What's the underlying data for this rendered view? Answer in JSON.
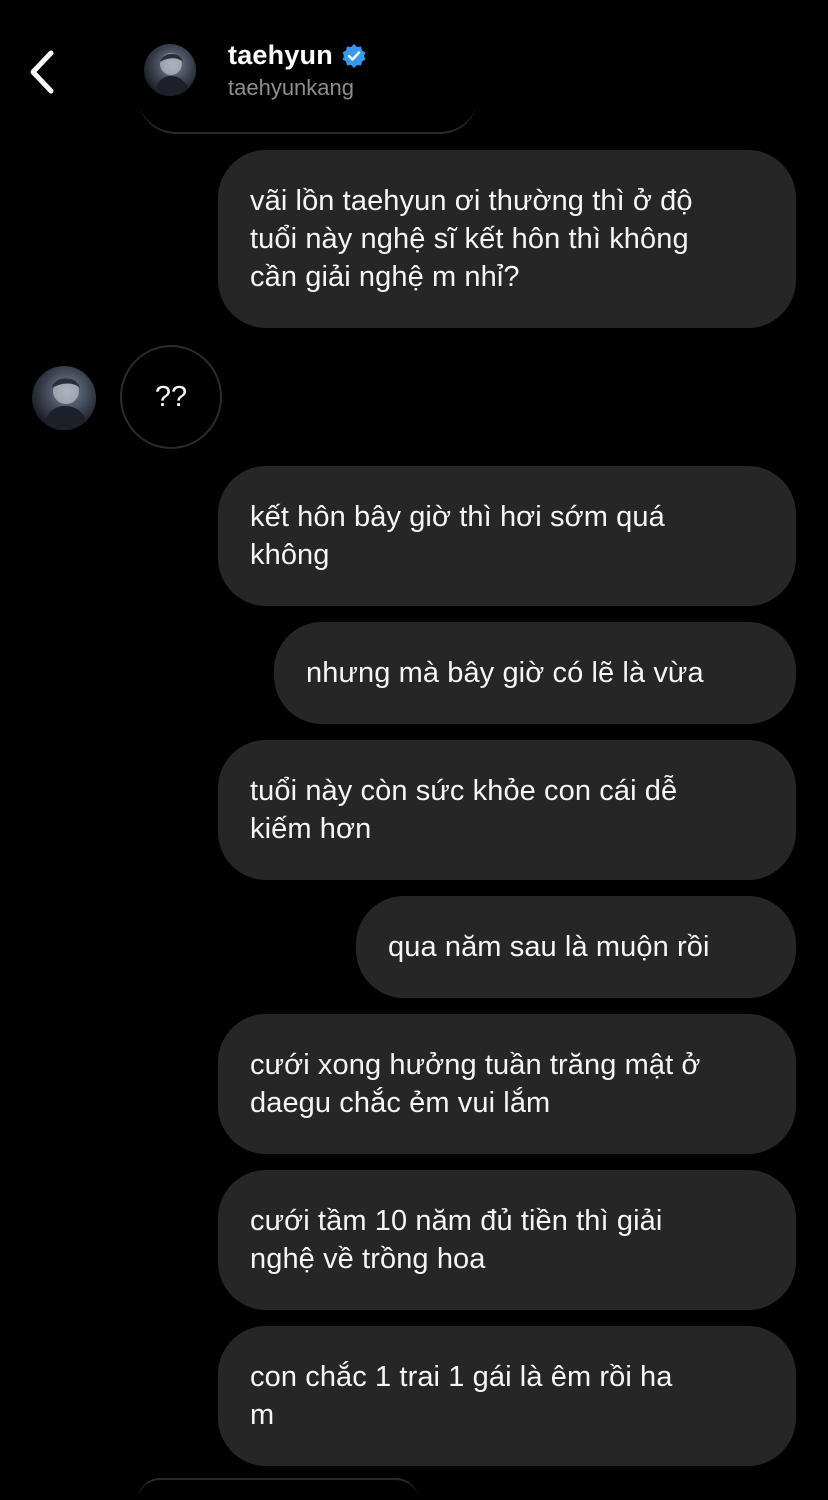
{
  "header": {
    "name": "taehyun",
    "username": "taehyunkang",
    "verified_color": "#3897f0"
  },
  "incoming": {
    "text": "??"
  },
  "messages": [
    {
      "lines": [
        "vãi lồn taehyun ơi thường thì ở độ",
        "tuổi này nghệ sĩ kết hôn thì không",
        "cần giải nghệ m nhỉ?"
      ]
    },
    {
      "lines": [
        "kết hôn bây giờ thì hơi sớm quá",
        "không"
      ]
    },
    {
      "lines": [
        "nhưng mà bây giờ có lẽ là vừa"
      ]
    },
    {
      "lines": [
        "tuổi này còn sức khỏe con cái dễ",
        "kiếm hơn"
      ]
    },
    {
      "lines": [
        "qua năm sau là muộn rồi"
      ]
    },
    {
      "lines": [
        "cưới xong hưởng tuần trăng mật ở",
        "daegu chắc ẻm vui lắm"
      ]
    },
    {
      "lines": [
        "cưới tầm 10 năm đủ tiền thì giải",
        "nghệ về trồng hoa"
      ]
    },
    {
      "lines": [
        "con chắc 1 trai 1 gái là êm rồi ha",
        "m"
      ]
    }
  ],
  "colors": {
    "background": "#000000",
    "bubble": "#262626",
    "secondary_text": "#8e8e8e"
  },
  "icons": {
    "back": "chevron-left-icon",
    "verified": "verified-badge-icon"
  }
}
